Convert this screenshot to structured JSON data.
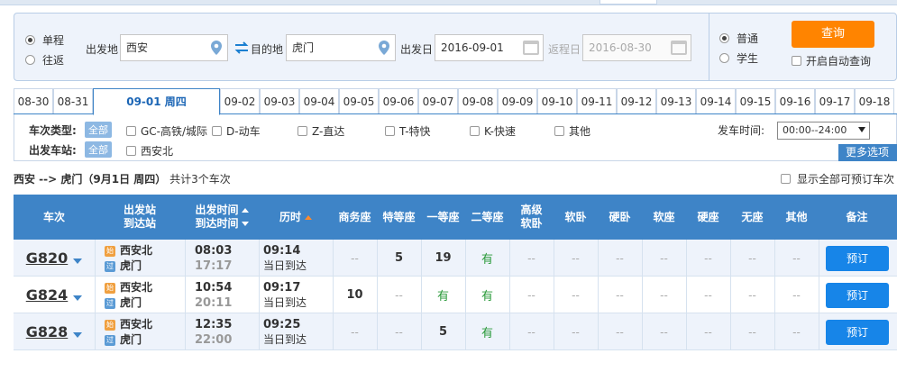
{
  "trip_type": {
    "options": [
      "单程",
      "往返"
    ],
    "selected": 0
  },
  "from": {
    "label": "出发地",
    "value": "西安"
  },
  "to": {
    "label": "目的地",
    "value": "虎门"
  },
  "depart_date": {
    "label": "出发日",
    "value": "2016-09-01"
  },
  "return_date": {
    "label": "返程日",
    "value": "2016-08-30"
  },
  "passenger": {
    "options": [
      "普通",
      "学生"
    ],
    "selected": 0
  },
  "search_button": "查询",
  "auto_query": "开启自动查询",
  "date_tabs": [
    "08-30",
    "08-31",
    "09-01 周四",
    "09-02",
    "09-03",
    "09-04",
    "09-05",
    "09-06",
    "09-07",
    "09-08",
    "09-09",
    "09-10",
    "09-11",
    "09-12",
    "09-13",
    "09-14",
    "09-15",
    "09-16",
    "09-17",
    "09-18"
  ],
  "active_date_index": 2,
  "filters": {
    "type_label": "车次类型:",
    "all_label": "全部",
    "types": [
      "GC-高铁/城际",
      "D-动车",
      "Z-直达",
      "T-特快",
      "K-快速",
      "其他"
    ],
    "station_label": "出发车站:",
    "stations": [
      "西安北"
    ],
    "depart_time_label": "发车时间:",
    "depart_time_value": "00:00--24:00",
    "more_options": "更多选项"
  },
  "summary": {
    "route": "西安 --> 虎门（9月1日  周四）",
    "count_text": "共计3个车次"
  },
  "show_all_label": "显示全部可预订车次",
  "table": {
    "headers": {
      "train": "车次",
      "stations": [
        "出发站",
        "到达站"
      ],
      "times": [
        "出发时间",
        "到达时间"
      ],
      "duration": "历时",
      "seats": [
        "商务座",
        "特等座",
        "一等座",
        "二等座",
        "高级软卧",
        "软卧",
        "硬卧",
        "软座",
        "硬座",
        "无座",
        "其他"
      ],
      "remark": "备注"
    },
    "badges": {
      "start": "始",
      "pass": "过"
    },
    "book_label": "预订",
    "rows": [
      {
        "train": "G820",
        "from": "西安北",
        "to": "虎门",
        "dep": "08:03",
        "arr": "17:17",
        "duration": "09:14",
        "arrive_note": "当日到达",
        "seats": [
          "--",
          "5",
          "19",
          "有",
          "--",
          "--",
          "--",
          "--",
          "--",
          "--",
          "--"
        ]
      },
      {
        "train": "G824",
        "from": "西安北",
        "to": "虎门",
        "dep": "10:54",
        "arr": "20:11",
        "duration": "09:17",
        "arrive_note": "当日到达",
        "seats": [
          "10",
          "--",
          "有",
          "有",
          "--",
          "--",
          "--",
          "--",
          "--",
          "--",
          "--"
        ]
      },
      {
        "train": "G828",
        "from": "西安北",
        "to": "虎门",
        "dep": "12:35",
        "arr": "22:00",
        "duration": "09:25",
        "arrive_note": "当日到达",
        "seats": [
          "--",
          "--",
          "5",
          "有",
          "--",
          "--",
          "--",
          "--",
          "--",
          "--",
          "--"
        ]
      }
    ]
  },
  "colors": {
    "header_blue": "#3e84c7",
    "search_orange": "#ff8400",
    "book_blue": "#1785e8",
    "available_green": "#2a9a3a"
  }
}
